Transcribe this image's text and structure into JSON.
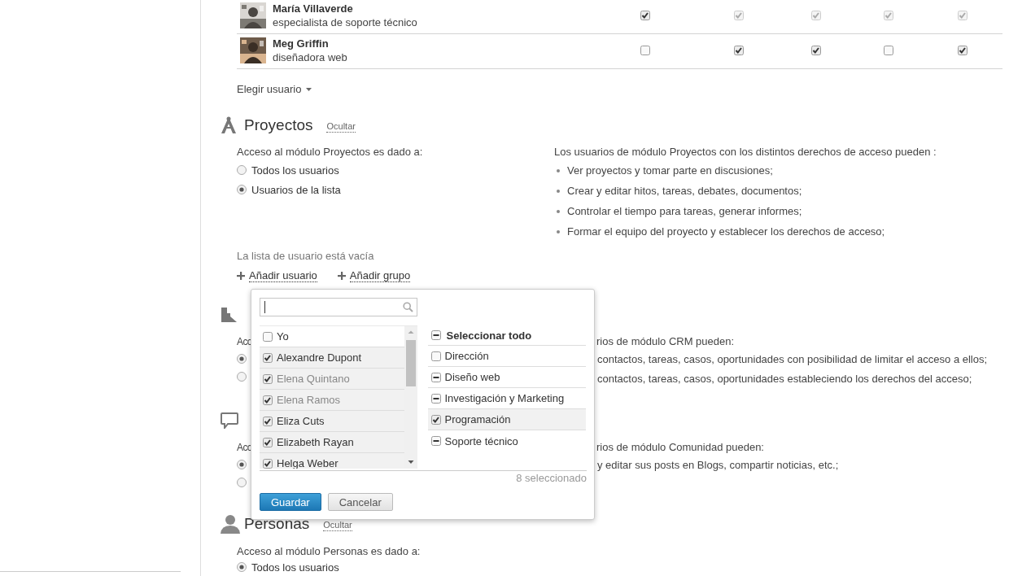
{
  "user_table": {
    "rows": [
      {
        "name": "María Villaverde",
        "role": "especialista de soporte técnico",
        "permissions": [
          {
            "checked": true,
            "disabled": false
          },
          {
            "checked": true,
            "disabled": true
          },
          {
            "checked": true,
            "disabled": true
          },
          {
            "checked": true,
            "disabled": true
          },
          {
            "checked": true,
            "disabled": true
          }
        ]
      },
      {
        "name": "Meg Griffin",
        "role": "diseñadora web",
        "permissions": [
          {
            "checked": false,
            "disabled": false
          },
          {
            "checked": true,
            "disabled": false
          },
          {
            "checked": true,
            "disabled": false
          },
          {
            "checked": false,
            "disabled": false
          },
          {
            "checked": true,
            "disabled": false
          }
        ]
      }
    ],
    "choose_user": "Elegir usuario"
  },
  "sections": [
    {
      "kind": "full",
      "title": "Proyectos",
      "hide_link": "Ocultar",
      "access_label": "Acceso al módulo Proyectos es dado a:",
      "options": [
        {
          "label": "Todos los usuarios",
          "selected": false
        },
        {
          "label": "Usuarios de la lista",
          "selected": true
        }
      ],
      "rights_intro": "Los usuarios de módulo Proyectos con los distintos derechos de acceso pueden :",
      "rights": [
        "Ver proyectos y tomar parte en discusiones;",
        "Crear y editar hitos, tareas, debates, documentos;",
        "Controlar el tiempo para tareas, generar informes;",
        "Formar el equipo del proyecto y establecer los derechos de acceso;"
      ],
      "empty_note": "La lista de usuario está vacía",
      "add_links": [
        "Añadir usuario",
        "Añadir grupo"
      ]
    },
    {
      "kind": "covered",
      "access_label": "Acc",
      "options": [
        {
          "selected": true
        },
        {
          "selected": false
        }
      ],
      "rights_intro": "rios de módulo CRM pueden:",
      "rights": [
        "contactos, tareas, casos, oportunidades con posibilidad de limitar el acceso a ellos;",
        "contactos, tareas, casos, oportunidades estableciendo los derechos del acceso;"
      ]
    },
    {
      "kind": "covered",
      "access_label": "Acc",
      "options": [
        {
          "selected": true
        },
        {
          "selected": false
        }
      ],
      "rights_intro": "rios de módulo Comunidad pueden:",
      "rights": [
        "y editar sus posts en Blogs, compartir noticias, etc.;"
      ]
    },
    {
      "kind": "full",
      "title": "Personas",
      "hide_link": "Ocultar",
      "access_label": "Acceso al módulo Personas es dado a:",
      "options": [
        {
          "label": "Todos los usuarios",
          "selected": true
        }
      ]
    }
  ],
  "picker": {
    "users": [
      {
        "name": "Yo",
        "checked": false,
        "disabled": false
      },
      {
        "name": "Alexandre Dupont",
        "checked": true,
        "disabled": false
      },
      {
        "name": "Elena Quintano",
        "checked": true,
        "disabled": true
      },
      {
        "name": "Elena Ramos",
        "checked": true,
        "disabled": true
      },
      {
        "name": "Eliza Cuts",
        "checked": true,
        "disabled": false
      },
      {
        "name": "Elizabeth Rayan",
        "checked": true,
        "disabled": false
      },
      {
        "name": "Helga Weber",
        "checked": true,
        "disabled": false
      }
    ],
    "select_all": {
      "label": "Seleccionar todo",
      "checked": false,
      "partial": true
    },
    "groups": [
      {
        "name": "Dirección",
        "checked": false,
        "partial": false
      },
      {
        "name": "Diseño web",
        "checked": false,
        "partial": true
      },
      {
        "name": "Investigación y Marketing",
        "checked": false,
        "partial": true
      },
      {
        "name": "Programación",
        "checked": true,
        "partial": false
      },
      {
        "name": "Soporte técnico",
        "checked": false,
        "partial": true
      }
    ],
    "count": "8 seleccionado",
    "buttons": [
      "Guardar",
      "Cancelar"
    ]
  }
}
